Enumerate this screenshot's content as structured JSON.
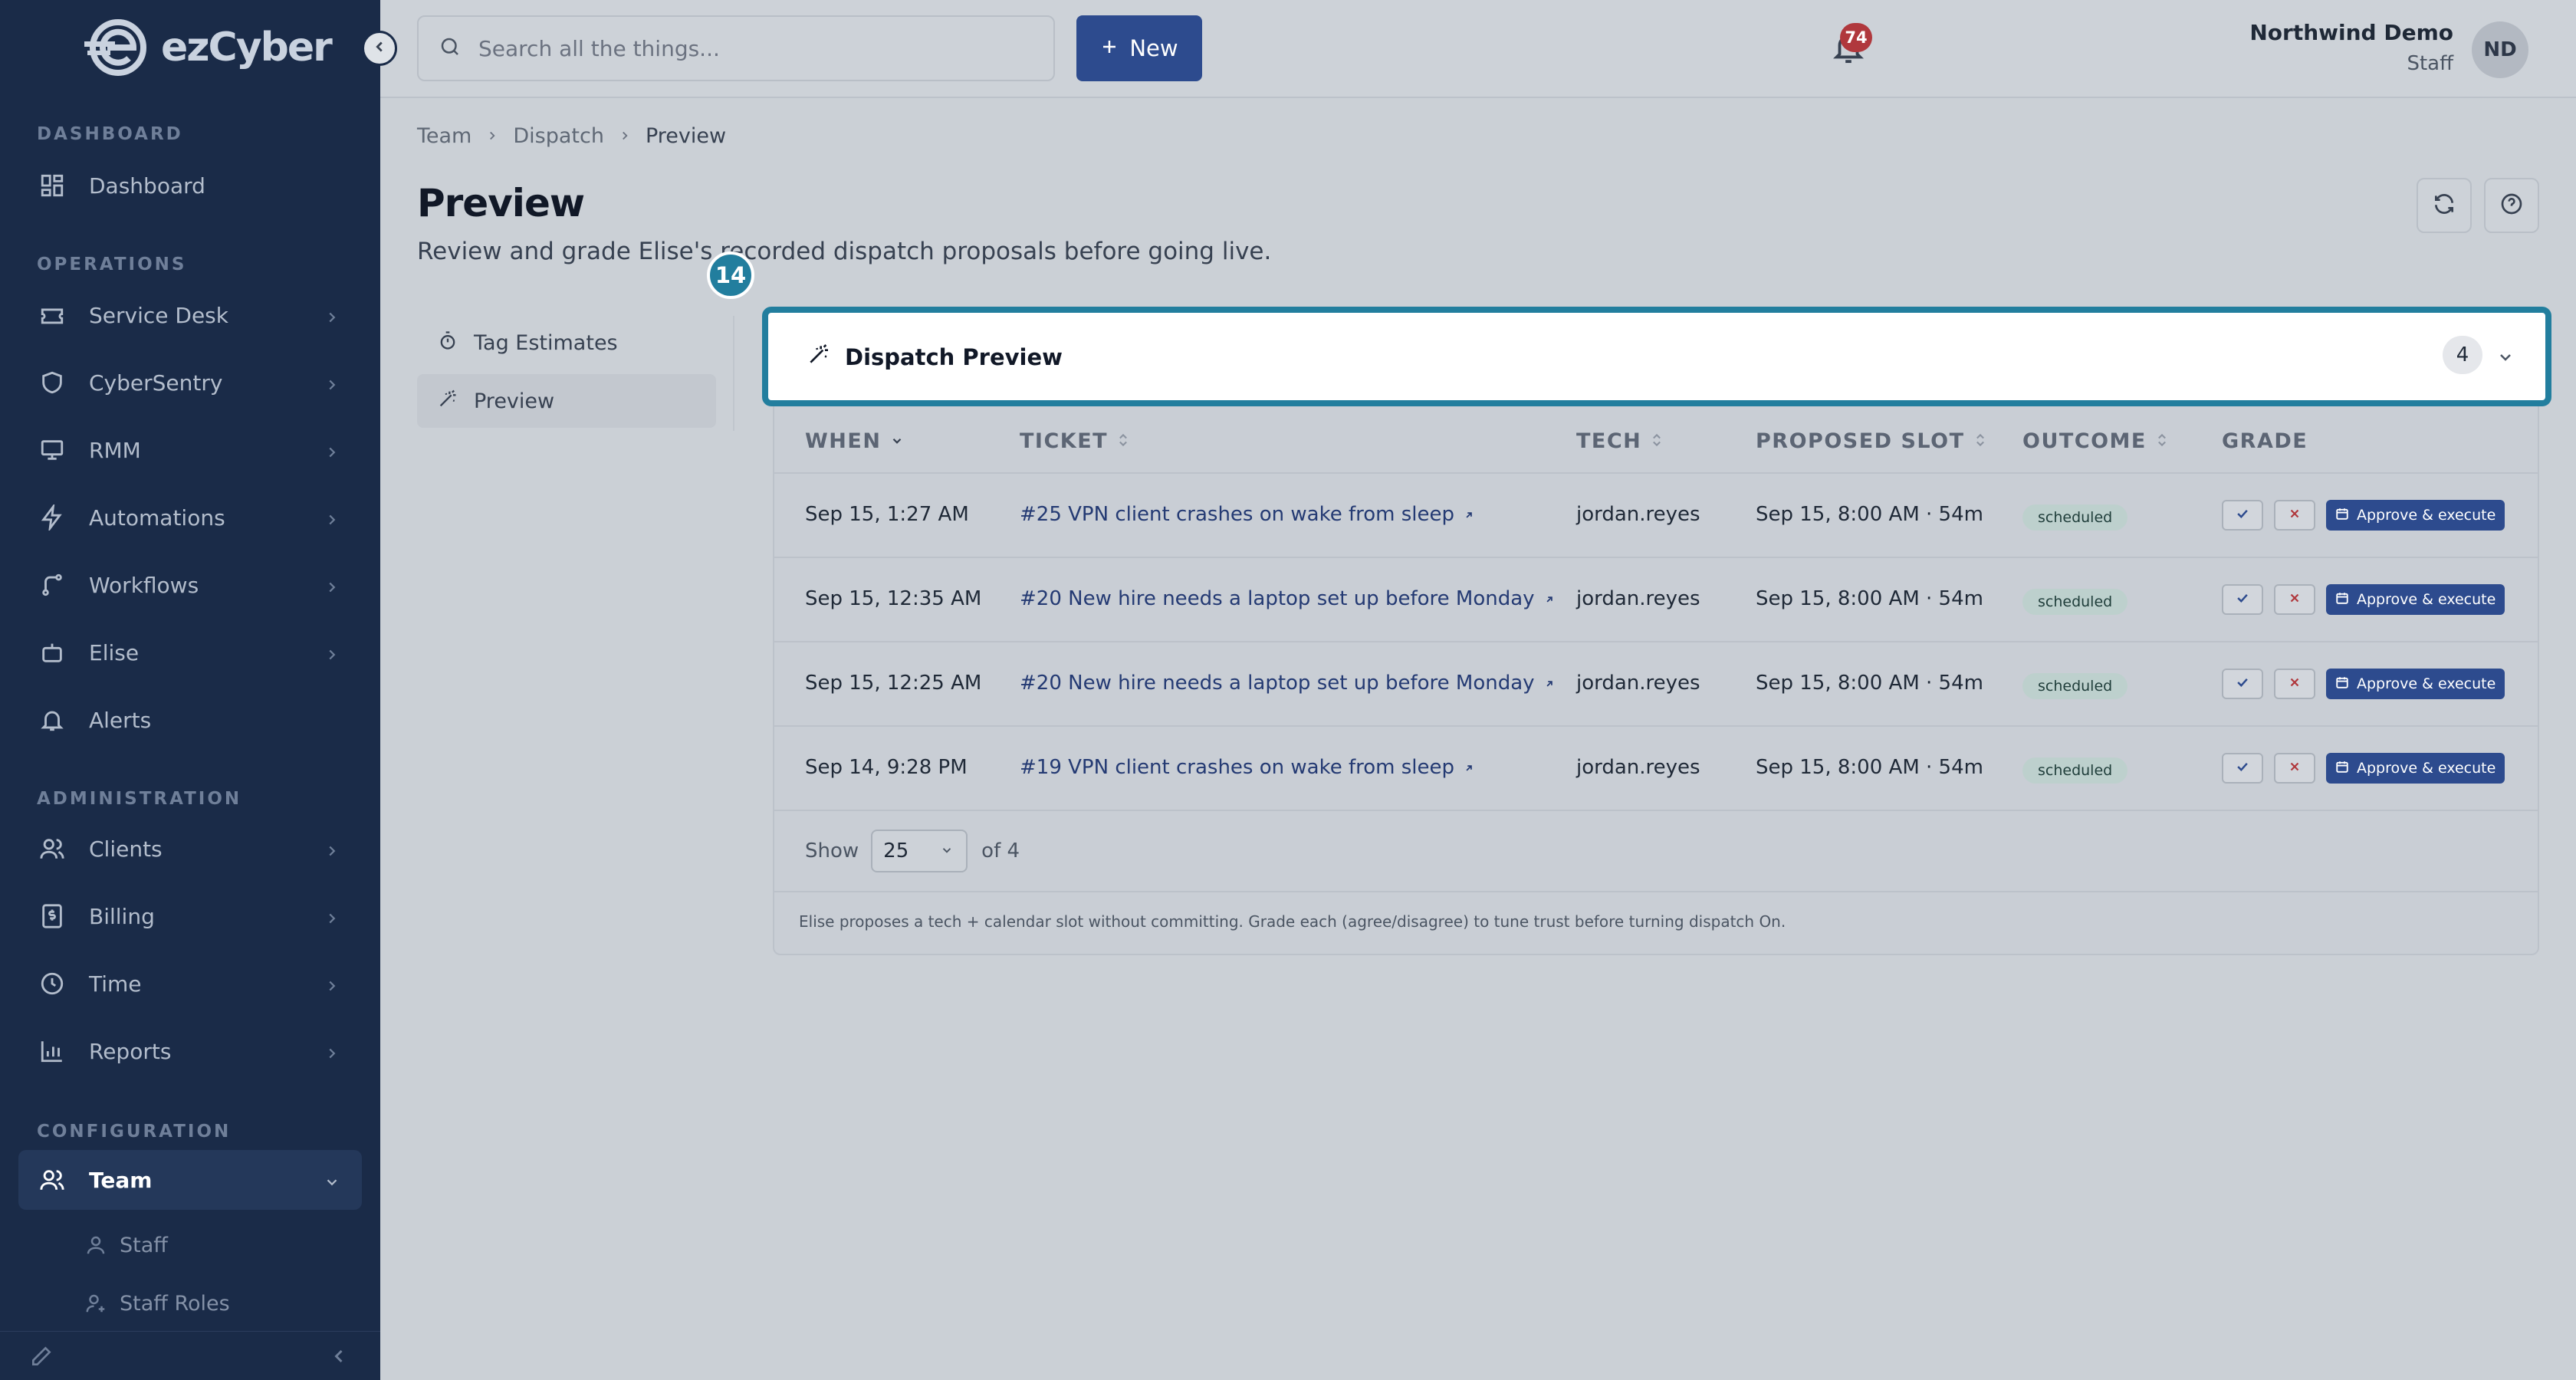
{
  "brand": {
    "name": "ezCyber"
  },
  "sidebar": {
    "sections": {
      "dashboard": "DASHBOARD",
      "operations": "OPERATIONS",
      "administration": "ADMINISTRATION",
      "configuration": "CONFIGURATION"
    },
    "items": [
      {
        "label": "Dashboard",
        "icon": "dashboard-icon"
      },
      {
        "label": "Service Desk",
        "icon": "ticket-icon"
      },
      {
        "label": "CyberSentry",
        "icon": "shield-icon"
      },
      {
        "label": "RMM",
        "icon": "monitor-icon"
      },
      {
        "label": "Automations",
        "icon": "bolt-icon"
      },
      {
        "label": "Workflows",
        "icon": "workflow-icon"
      },
      {
        "label": "Elise",
        "icon": "bot-icon"
      },
      {
        "label": "Alerts",
        "icon": "bell-icon"
      },
      {
        "label": "Clients",
        "icon": "users-icon"
      },
      {
        "label": "Billing",
        "icon": "dollar-icon"
      },
      {
        "label": "Time",
        "icon": "clock-icon"
      },
      {
        "label": "Reports",
        "icon": "chart-icon"
      },
      {
        "label": "Team",
        "icon": "team-icon"
      }
    ],
    "team_subitems": [
      {
        "label": "Staff"
      },
      {
        "label": "Staff Roles"
      }
    ]
  },
  "topbar": {
    "search_placeholder": "Search all the things...",
    "new_label": "New",
    "notification_count": "74",
    "user_name": "Northwind Demo",
    "user_role": "Staff",
    "user_initials": "ND"
  },
  "breadcrumb": [
    "Team",
    "Dispatch",
    "Preview"
  ],
  "page": {
    "title": "Preview",
    "subtitle": "Review and grade Elise's recorded dispatch proposals before going live."
  },
  "subnav": [
    {
      "label": "Tag Estimates",
      "icon": "timer-icon"
    },
    {
      "label": "Preview",
      "icon": "wand-icon"
    }
  ],
  "step_badge": "14",
  "card": {
    "title": "Dispatch Preview",
    "count": "4"
  },
  "table": {
    "columns": [
      "WHEN",
      "TICKET",
      "TECH",
      "PROPOSED SLOT",
      "OUTCOME",
      "GRADE"
    ],
    "rows": [
      {
        "when": "Sep 15, 1:27 AM",
        "ticket": "#25 VPN client crashes on wake from sleep",
        "tech": "jordan.reyes",
        "slot": "Sep 15, 8:00 AM · 54m",
        "outcome": "scheduled"
      },
      {
        "when": "Sep 15, 12:35 AM",
        "ticket": "#20 New hire needs a laptop set up before Monday",
        "tech": "jordan.reyes",
        "slot": "Sep 15, 8:00 AM · 54m",
        "outcome": "scheduled"
      },
      {
        "when": "Sep 15, 12:25 AM",
        "ticket": "#20 New hire needs a laptop set up before Monday",
        "tech": "jordan.reyes",
        "slot": "Sep 15, 8:00 AM · 54m",
        "outcome": "scheduled"
      },
      {
        "when": "Sep 14, 9:28 PM",
        "ticket": "#19 VPN client crashes on wake from sleep",
        "tech": "jordan.reyes",
        "slot": "Sep 15, 8:00 AM · 54m",
        "outcome": "scheduled"
      }
    ],
    "approve_label": "Approve & execute",
    "show_label": "Show",
    "page_size": "25",
    "of_label": "of 4"
  },
  "footnote": "Elise proposes a tech + calendar slot without committing. Grade each (agree/disagree) to tune trust before turning dispatch On.",
  "colors": {
    "sidebar": "#1a2b48",
    "accent": "#2d4b8e",
    "highlight": "#227e9e",
    "badge": "#b0383d"
  }
}
